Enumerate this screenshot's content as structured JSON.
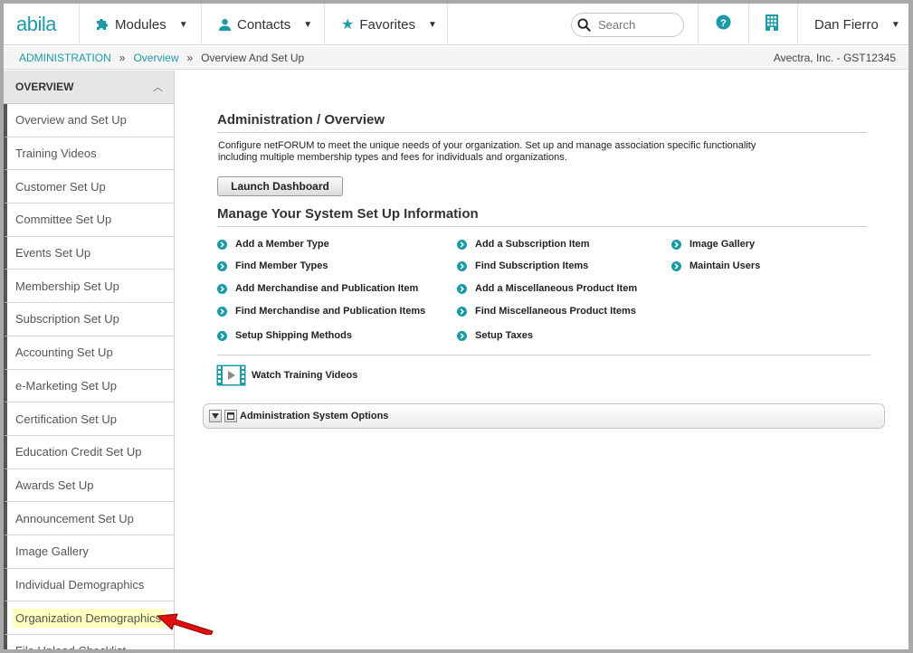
{
  "topnav": {
    "logo": "abila",
    "modules_label": "Modules",
    "contacts_label": "Contacts",
    "favorites_label": "Favorites",
    "search_placeholder": "Search",
    "user_name": "Dan Fierro"
  },
  "breadcrumb": {
    "items": [
      "ADMINISTRATION",
      "Overview"
    ],
    "separator": "»",
    "current": "Overview And Set Up",
    "org": "Avectra, Inc. - GST12345"
  },
  "sidebar": {
    "header": "OVERVIEW",
    "items": [
      "Overview and Set Up",
      "Training Videos",
      "Customer Set Up",
      "Committee Set Up",
      "Events Set Up",
      "Membership Set Up",
      "Subscription Set Up",
      "Accounting Set Up",
      "e-Marketing Set Up",
      "Certification Set Up",
      "Education Credit Set Up",
      "Awards Set Up",
      "Announcement Set Up",
      "Image Gallery",
      "Individual Demographics",
      "Organization Demographics",
      "File Upload Checklist"
    ]
  },
  "main": {
    "title": "Administration / Overview",
    "description_line1": "Configure netFORUM to meet the unique needs of your organization. Set up and manage association specific functionality",
    "description_line2": "including multiple membership types and fees for individuals and organizations.",
    "launch_button": "Launch Dashboard",
    "setup_title": "Manage Your System Set Up Information",
    "links": [
      "Add a Member Type",
      "Find Member Types",
      "Add Merchandise and Publication Item",
      "Find Merchandise and Publication Items",
      "Setup Shipping Methods",
      "Add a Subscription Item",
      "Find Subscription Items",
      "Add a Miscellaneous Product Item",
      "Find Miscellaneous Product Items",
      "Setup Taxes",
      "Image Gallery",
      "Maintain Users"
    ],
    "video_link": "Watch Training Videos",
    "panel_title": "Administration System Options"
  },
  "colors": {
    "accent": "#1d9aa8",
    "highlight": "#ffffc0",
    "arrow": "#e01010"
  }
}
